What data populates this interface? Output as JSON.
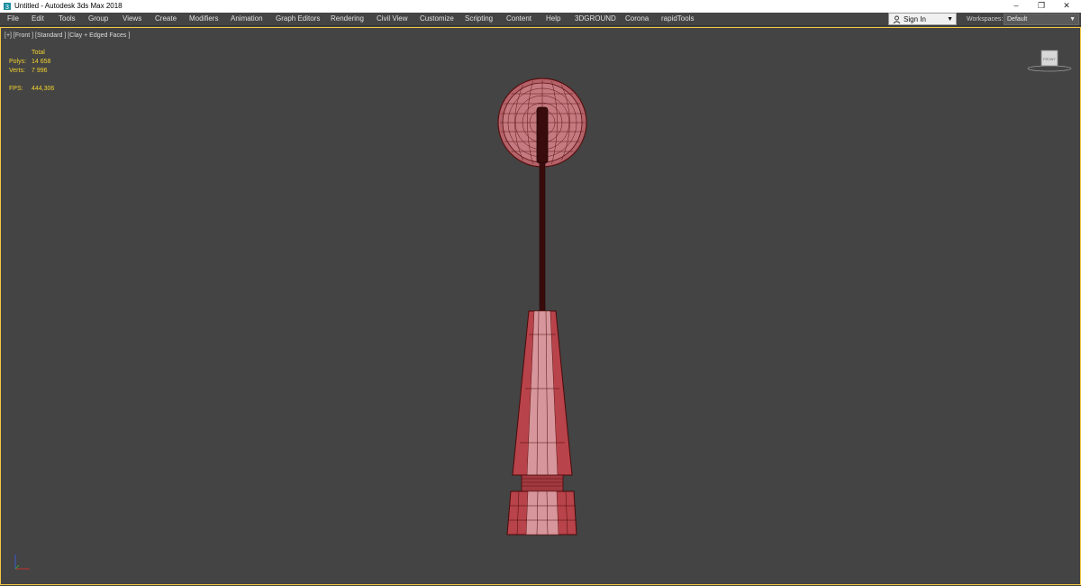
{
  "window": {
    "title": "Untitled - Autodesk 3ds Max 2018",
    "minimize": "–",
    "restore": "❐",
    "close": "✕"
  },
  "menu": [
    "File",
    "Edit",
    "Tools",
    "Group",
    "Views",
    "Create",
    "Modifiers",
    "Animation",
    "Graph Editors",
    "Rendering",
    "Civil View",
    "Customize",
    "Scripting",
    "Content",
    "Help",
    "3DGROUND",
    "Corona",
    "rapidTools"
  ],
  "signin": {
    "label": "Sign In"
  },
  "workspaces": {
    "label": "Workspaces:",
    "value": "Default"
  },
  "viewport": {
    "label": "[+] [Front ] [Standard ] [Clay + Edged Faces ]",
    "stats": {
      "header": "Total",
      "polys_label": "Polys:",
      "polys": "14 658",
      "verts_label": "Verts:",
      "verts": "7 996",
      "fps_label": "FPS:",
      "fps": "444,306"
    },
    "viewcube_face": "FRONT"
  },
  "colors": {
    "accent_border": "#f5c842",
    "stats_text": "#f2d22e",
    "model_fill": "#c97a80",
    "model_edge": "#6a1010"
  },
  "icons": {
    "app": "3dsmax-icon",
    "user": "user-icon",
    "viewcube": "viewcube-icon",
    "axis": "axis-tripod-icon"
  }
}
